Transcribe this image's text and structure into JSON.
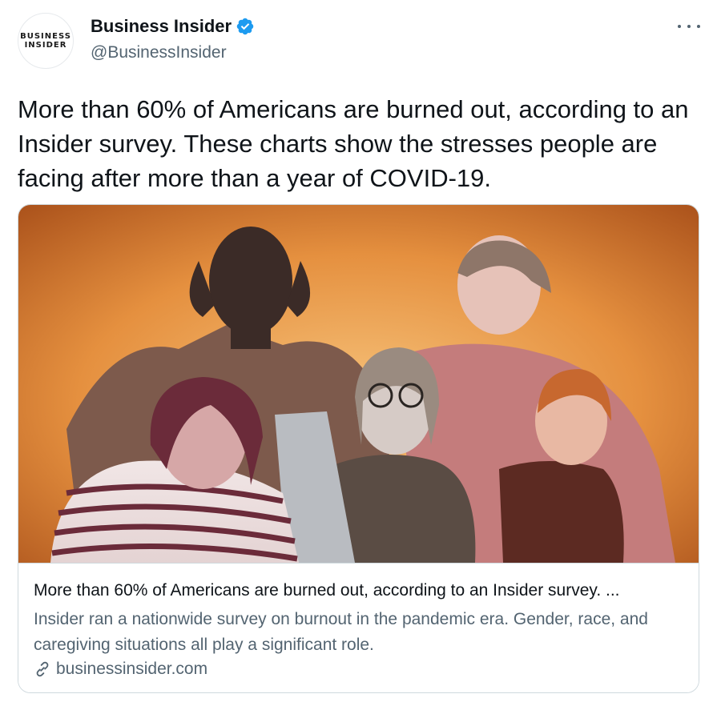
{
  "account": {
    "display_name": "Business Insider",
    "handle": "@BusinessInsider",
    "avatar_text": [
      "BUSINESS",
      "INSIDER"
    ],
    "verified": true,
    "verified_color": "#1d9bf0"
  },
  "tweet": {
    "text": "More than 60% of Americans are burned out, according to an Insider survey. These charts show the stresses people are facing after more than a year of COVID-19."
  },
  "card": {
    "title": "More than 60% of Americans are burned out, according to an Insider survey. ...",
    "description": "Insider ran a nationwide survey on burnout in the pandemic era. Gender, race, and caregiving situations all play a significant role.",
    "domain": "businessinsider.com",
    "image_alt": "stressed-people-collage",
    "link_icon": "link-icon"
  },
  "colors": {
    "text_primary": "#0f1419",
    "text_secondary": "#536471",
    "border": "#cfd9de",
    "image_background": "#e08a3a"
  }
}
